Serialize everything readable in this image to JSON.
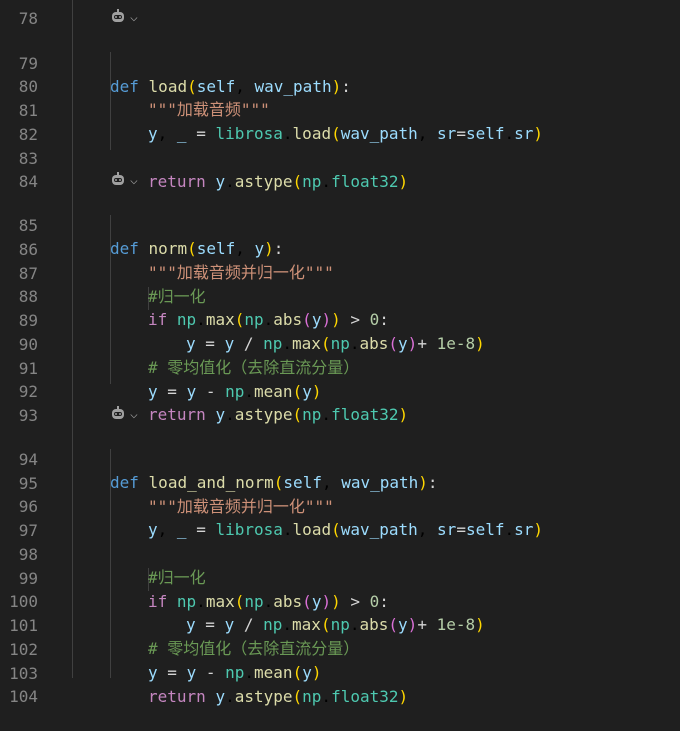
{
  "editor": {
    "lines": [
      {
        "n": "78",
        "t": ""
      },
      {
        "n": "79",
        "t": "def load(self, wav_path):"
      },
      {
        "n": "80",
        "t": "\"\"\"加载音频\"\"\""
      },
      {
        "n": "81",
        "t": "y, _ = librosa.load(wav_path, sr=self.sr)"
      },
      {
        "n": "82",
        "t": ""
      },
      {
        "n": "83",
        "t": "return y.astype(np.float32)"
      },
      {
        "n": "84",
        "t": ""
      },
      {
        "n": "85",
        "t": "def norm(self, y):"
      },
      {
        "n": "86",
        "t": "\"\"\"加载音频并归一化\"\"\""
      },
      {
        "n": "87",
        "t": "#归一化"
      },
      {
        "n": "88",
        "t": "if np.max(np.abs(y)) > 0:"
      },
      {
        "n": "89",
        "t": "y = y / np.max(np.abs(y)+ 1e-8)"
      },
      {
        "n": "90",
        "t": "# 零均值化（去除直流分量）"
      },
      {
        "n": "91",
        "t": "y = y - np.mean(y)"
      },
      {
        "n": "92",
        "t": "return y.astype(np.float32)"
      },
      {
        "n": "93",
        "t": ""
      },
      {
        "n": "94",
        "t": "def load_and_norm(self, wav_path):"
      },
      {
        "n": "95",
        "t": "\"\"\"加载音频并归一化\"\"\""
      },
      {
        "n": "96",
        "t": "y, _ = librosa.load(wav_path, sr=self.sr)"
      },
      {
        "n": "97",
        "t": ""
      },
      {
        "n": "98",
        "t": "#归一化"
      },
      {
        "n": "99",
        "t": "if np.max(np.abs(y)) > 0:"
      },
      {
        "n": "100",
        "t": "y = y / np.max(np.abs(y)+ 1e-8)"
      },
      {
        "n": "101",
        "t": "# 零均值化（去除直流分量）"
      },
      {
        "n": "102",
        "t": "y = y - np.mean(y)"
      },
      {
        "n": "103",
        "t": "return y.astype(np.float32)"
      },
      {
        "n": "104",
        "t": ""
      }
    ],
    "codelens_icon": "copilot-robot-icon",
    "codelens_chevron": "⌵"
  },
  "colors": {
    "background": "#1f1f1f",
    "line_number": "#858585",
    "keyword": "#569cd6",
    "control": "#c586c0",
    "function": "#dcdcaa",
    "variable": "#9cdcfe",
    "module": "#4ec9b0",
    "string": "#ce9178",
    "number": "#b5cea8",
    "comment": "#6a9955"
  }
}
